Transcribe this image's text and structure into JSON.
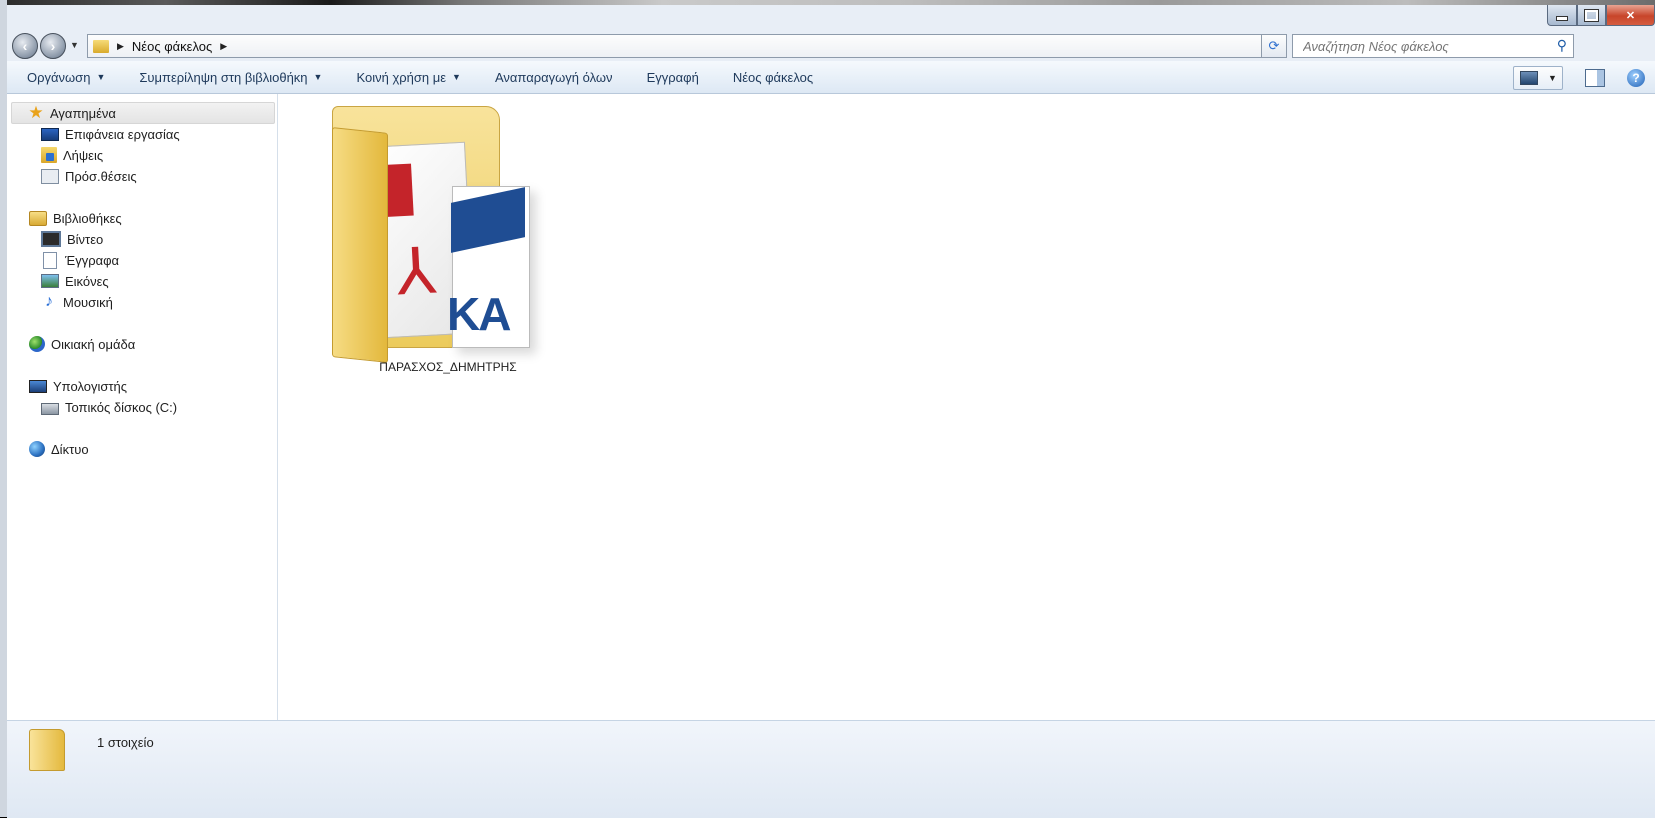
{
  "window": {
    "address": {
      "crumb": "Νέος φάκελος"
    },
    "search_placeholder": "Αναζήτηση Νέος φάκελος"
  },
  "toolbar": {
    "items": [
      {
        "label": "Οργάνωση",
        "has_menu": true
      },
      {
        "label": "Συμπερίληψη στη βιβλιοθήκη",
        "has_menu": true
      },
      {
        "label": "Κοινή χρήση με",
        "has_menu": true
      },
      {
        "label": "Αναπαραγωγή όλων",
        "has_menu": false
      },
      {
        "label": "Εγγραφή",
        "has_menu": false
      },
      {
        "label": "Νέος φάκελος",
        "has_menu": false
      }
    ]
  },
  "navpane": {
    "favorites": {
      "label": "Αγαπημένα",
      "icon": "star-icon"
    },
    "desktop": {
      "label": "Επιφάνεια εργασίας",
      "icon": "desktop-icon"
    },
    "downloads": {
      "label": "Λήψεις",
      "icon": "downloads-icon"
    },
    "recent": {
      "label": "Πρόσ.θέσεις",
      "icon": "recent-places-icon"
    },
    "libraries": {
      "label": "Βιβλιοθήκες",
      "icon": "libraries-icon"
    },
    "videos": {
      "label": "Βίντεο",
      "icon": "video-icon"
    },
    "documents": {
      "label": "Έγγραφα",
      "icon": "documents-icon"
    },
    "pictures": {
      "label": "Εικόνες",
      "icon": "pictures-icon"
    },
    "music": {
      "label": "Μουσική",
      "icon": "music-icon"
    },
    "homegroup": {
      "label": "Οικιακή ομάδα",
      "icon": "homegroup-icon"
    },
    "computer": {
      "label": "Υπολογιστής",
      "icon": "computer-icon"
    },
    "local_disk": {
      "label": "Τοπικός δίσκος (C:)",
      "icon": "disk-icon"
    },
    "network": {
      "label": "Δίκτυο",
      "icon": "network-icon"
    }
  },
  "content": {
    "items": [
      {
        "name": "ΠΑΡΑΣΧΟΣ_ΔΗΜΗΤΡΗΣ",
        "type": "folder",
        "preview_text": "KA"
      }
    ]
  },
  "status": {
    "count_text": "1 στοιχείο"
  },
  "colors": {
    "toolbar_text": "#1e395b",
    "close_button": "#c7452a",
    "folder": "#eccb5c"
  }
}
